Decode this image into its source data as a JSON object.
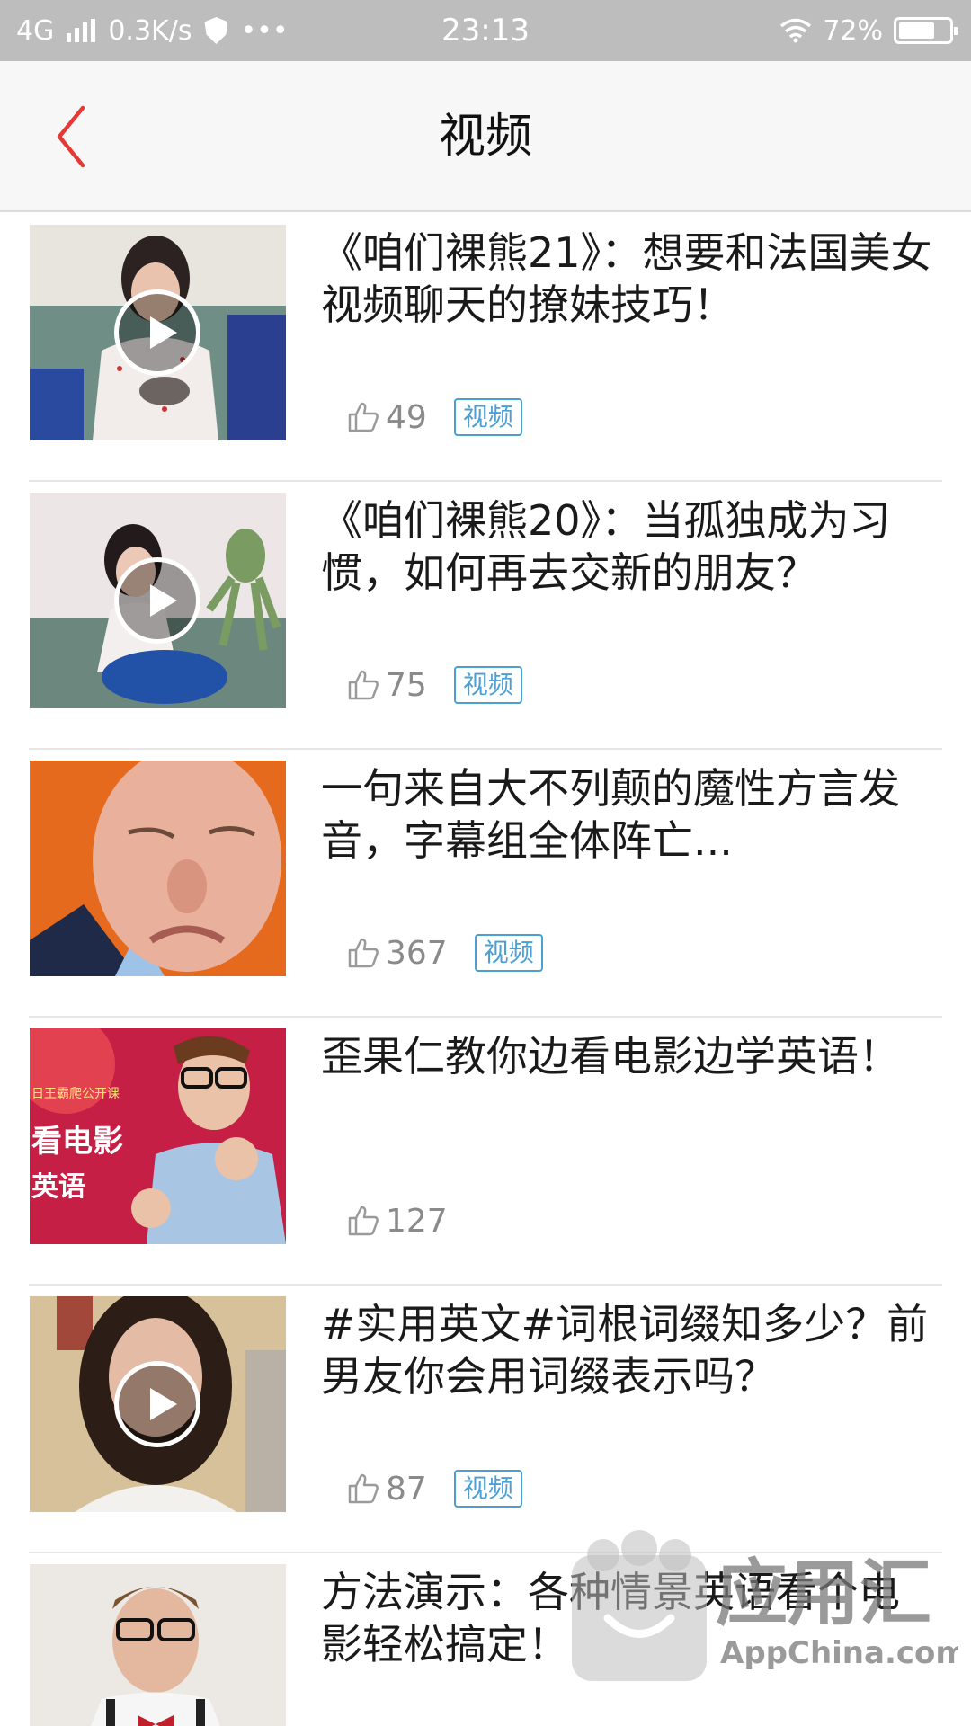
{
  "status_bar": {
    "network": "4G",
    "speed": "0.3K/s",
    "more": "•••",
    "time": "23:13",
    "battery": "72%",
    "battery_level": 0.72
  },
  "nav": {
    "title": "视频",
    "back_icon": "chevron-left-icon",
    "accent_color": "#e53935"
  },
  "items": [
    {
      "title": "《咱们裸熊21》：想要和法国美女视频聊天的撩妹技巧！",
      "likes": "49",
      "tag": "视频",
      "has_play": true
    },
    {
      "title": "《咱们裸熊20》：当孤独成为习惯，如何再去交新的朋友？",
      "likes": "75",
      "tag": "视频",
      "has_play": true
    },
    {
      "title": "一句来自大不列颠的魔性方言发音，字幕组全体阵亡...",
      "likes": "367",
      "tag": "视频",
      "has_play": false
    },
    {
      "title": "歪果仁教你边看电影边学英语！",
      "likes": "127",
      "tag": "",
      "has_play": false,
      "thumb_text": [
        "日王霸爬公开课",
        "看电影",
        "英语"
      ]
    },
    {
      "title": "#实用英文#词根词缀知多少？前男友你会用词缀表示吗？",
      "likes": "87",
      "tag": "视频",
      "has_play": true
    },
    {
      "title": "方法演示：各种情景英语看个电影轻松搞定！",
      "likes": "",
      "tag": "",
      "has_play": false
    }
  ],
  "watermark": {
    "brand": "应用汇",
    "url": "AppChina.com"
  },
  "colors": {
    "status_bar": "#bdbdbd",
    "nav_bg": "#f7f7f7",
    "tag": "#4a9fd5",
    "likes": "#8a8a8a"
  }
}
